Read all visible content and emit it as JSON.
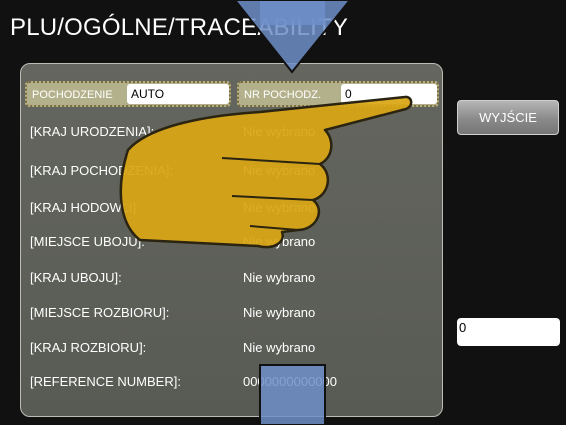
{
  "header": {
    "title": "PLU/OGÓLNE/TRACEABILITY"
  },
  "fields": {
    "origin": {
      "label": "POCHODZENIE",
      "value": "AUTO"
    },
    "origin_number": {
      "label": "NR POCHODZ.",
      "value": "0"
    }
  },
  "rows": [
    {
      "label": "[KRAJ URODZENIA]:",
      "value": "Nie wybrano"
    },
    {
      "label": "[KRAJ POCHODZENIA]:",
      "value": "Nie wybrano"
    },
    {
      "label": "[KRAJ HODOWLI]:",
      "value": "Nie wybrano"
    },
    {
      "label": "[MIEJSCE UBOJU]:",
      "value": "Nie wybrano"
    },
    {
      "label": "[KRAJ UBOJU]:",
      "value": "Nie wybrano"
    },
    {
      "label": "[MIEJSCE ROZBIORU]:",
      "value": "Nie wybrano"
    },
    {
      "label": "[KRAJ ROZBIORU]:",
      "value": "Nie wybrano"
    },
    {
      "label": "[REFERENCE NUMBER]:",
      "value": "0000000000000"
    }
  ],
  "exit_button": {
    "label": "WYJŚCIE"
  },
  "side_input": {
    "value": "0"
  },
  "colors": {
    "background": "#111111",
    "panel": "#5e6059",
    "field_bg": "#b3b18b",
    "overlay_blue": "#6f8fc9",
    "hand_yellow": "#d9a614"
  },
  "overlays": {
    "top_arrow": "scroll-up-arrow-icon",
    "bottom_arrow": "scroll-down-arrow-icon",
    "pointer": "pointing-hand-icon"
  }
}
